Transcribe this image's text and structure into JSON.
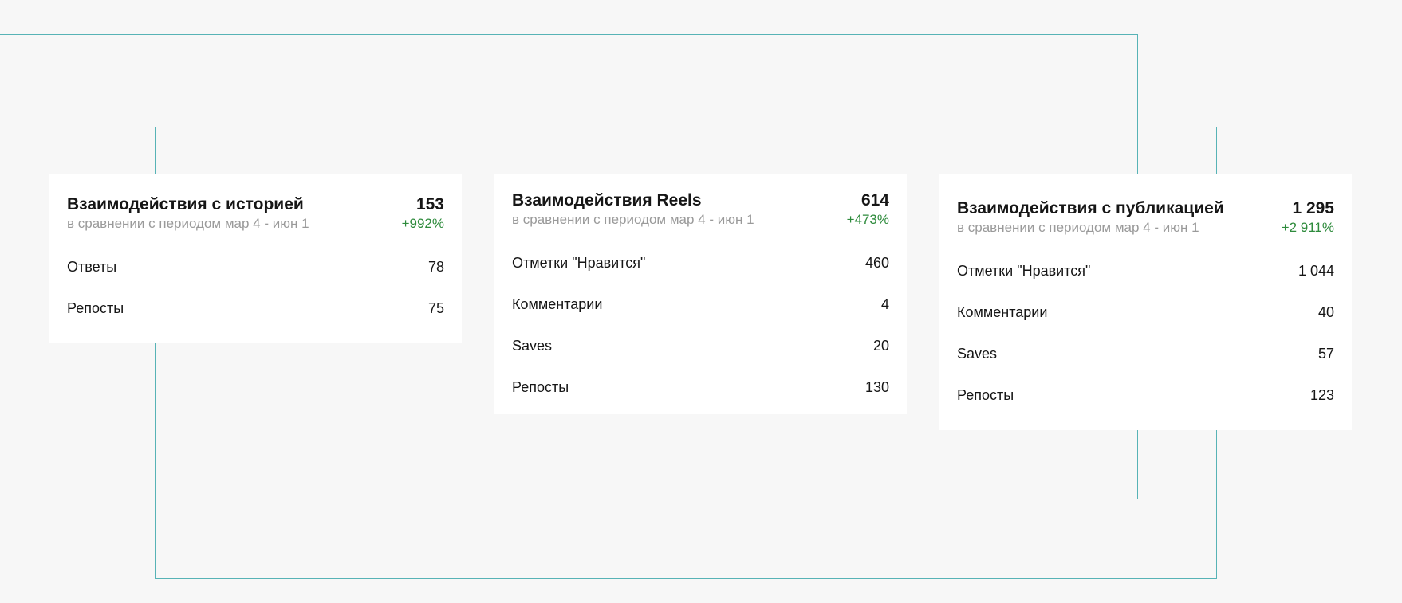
{
  "cards": [
    {
      "title": "Взаимодействия с историей",
      "subtitle": "в сравнении с периодом мар 4 - июн 1",
      "total": "153",
      "change": "+992%",
      "rows": [
        {
          "label": "Ответы",
          "value": "78"
        },
        {
          "label": "Репосты",
          "value": "75"
        }
      ]
    },
    {
      "title": "Взаимодействия Reels",
      "subtitle": "в сравнении с периодом мар 4 - июн 1",
      "total": "614",
      "change": "+473%",
      "rows": [
        {
          "label": "Отметки \"Нравится\"",
          "value": "460"
        },
        {
          "label": "Комментарии",
          "value": "4"
        },
        {
          "label": "Saves",
          "value": "20"
        },
        {
          "label": "Репосты",
          "value": "130"
        }
      ]
    },
    {
      "title": "Взаимодействия с публикацией",
      "subtitle": "в сравнении с периодом мар 4 - июн 1",
      "total": "1 295",
      "change": "+2 911%",
      "rows": [
        {
          "label": "Отметки \"Нравится\"",
          "value": "1 044"
        },
        {
          "label": "Комментарии",
          "value": "40"
        },
        {
          "label": "Saves",
          "value": "57"
        },
        {
          "label": "Репосты",
          "value": "123"
        }
      ]
    }
  ],
  "colors": {
    "background": "#f7f7f7",
    "card": "#ffffff",
    "frame": "#57b3b6",
    "positive_change": "#2e8b3c",
    "muted_text": "#9a9a9a"
  }
}
